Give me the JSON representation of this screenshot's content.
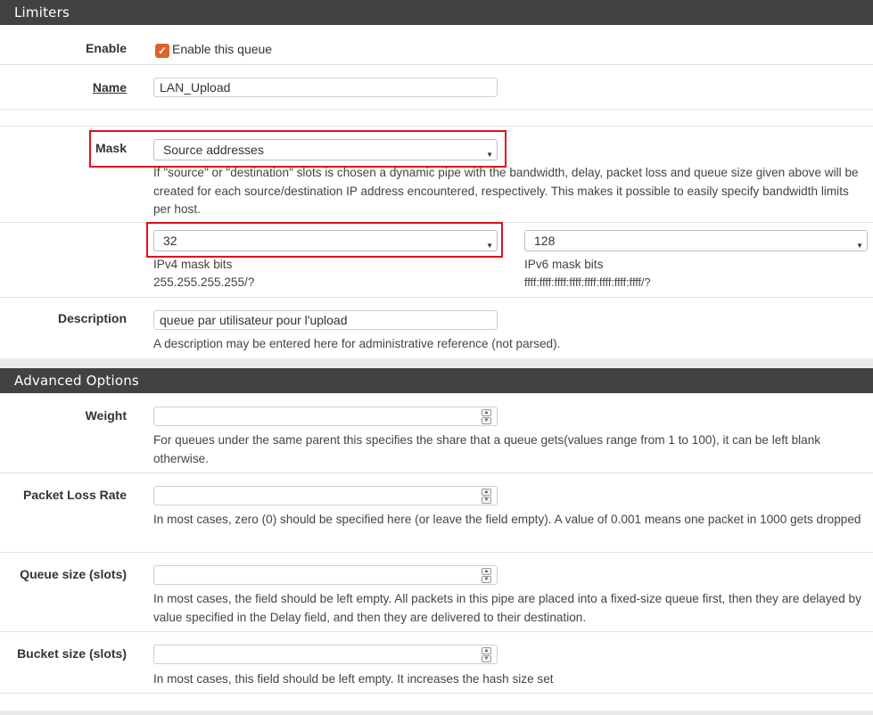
{
  "limiters": {
    "heading": "Limiters",
    "enable": {
      "label": "Enable",
      "checkbox_label": "Enable this queue",
      "checked": true
    },
    "name": {
      "label": "Name",
      "value": "LAN_Upload"
    },
    "mask": {
      "label": "Mask",
      "selected": "Source addresses",
      "help": "If \"source\" or \"destination\" slots is chosen a dynamic pipe with the bandwidth, delay, packet loss and queue size given above will be created for each source/destination IP address encountered, respectively. This makes it possible to easily specify bandwidth limits per host."
    },
    "ipv4": {
      "selected": "32",
      "label": "IPv4 mask bits",
      "hint": "255.255.255.255/?"
    },
    "ipv6": {
      "selected": "128",
      "label": "IPv6 mask bits",
      "hint": "ffff:ffff:ffff:ffff:ffff:ffff:ffff:ffff/?"
    },
    "description": {
      "label": "Description",
      "value": "queue par utilisateur pour l'upload",
      "help": "A description may be entered here for administrative reference (not parsed)."
    }
  },
  "advanced": {
    "heading": "Advanced Options",
    "weight": {
      "label": "Weight",
      "value": "",
      "help": "For queues under the same parent this specifies the share that a queue gets(values range from 1 to 100), it can be left blank otherwise."
    },
    "packet_loss": {
      "label": "Packet Loss Rate",
      "value": "",
      "help": "In most cases, zero (0) should be specified here (or leave the field empty). A value of 0.001 means one packet in 1000 gets dropped"
    },
    "queue_size": {
      "label": "Queue size (slots)",
      "value": "",
      "help": "In most cases, the field should be left empty. All packets in this pipe are placed into a fixed-size queue first, then they are delayed by value specified in the Delay field, and then they are delivered to their destination."
    },
    "bucket_size": {
      "label": "Bucket size (slots)",
      "value": "",
      "help": "In most cases, this field should be left empty. It increases the hash size set"
    }
  },
  "colors": {
    "heading_bg": "#424242",
    "checkbox": "#e0622a",
    "highlight": "#e0101a"
  }
}
